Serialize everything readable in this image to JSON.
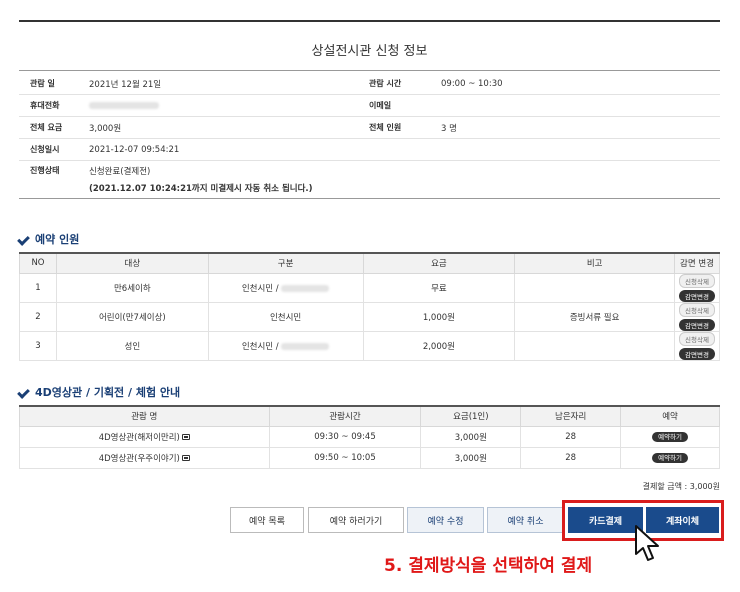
{
  "page_title": "상설전시관 신청 정보",
  "info": {
    "view_date_label": "관람 일",
    "view_date": "2021년 12월 21일",
    "view_time_label": "관람 시간",
    "view_time": "09:00 ~ 10:30",
    "phone_label": "휴대전화",
    "email_label": "이메일",
    "total_fee_label": "전체 요금",
    "total_fee": "3,000원",
    "total_people_label": "전체 인원",
    "total_people": "3 명",
    "applied_at_label": "신청일시",
    "applied_at": "2021-12-07 09:54:21",
    "status_label": "진행상태",
    "status": "신청완료(결제전)",
    "notice": "(2021.12.07 10:24:21까지 미결제시 자동 취소 됩니다.)"
  },
  "reservation": {
    "heading": "예약 인원",
    "columns": [
      "NO",
      "대상",
      "구분",
      "요금",
      "비고",
      "감면 변경"
    ],
    "rows": [
      {
        "no": "1",
        "target": "만6세이하",
        "category": "인천시민 /",
        "fee": "무료",
        "note": ""
      },
      {
        "no": "2",
        "target": "어린이(만7세이상)",
        "category": "인천시민",
        "fee": "1,000원",
        "note": "증빙서류 필요"
      },
      {
        "no": "3",
        "target": "성인",
        "category": "인천시민 /",
        "fee": "2,000원",
        "note": ""
      }
    ],
    "apply_label": "신청삭제",
    "change_label": "감면변경"
  },
  "program": {
    "heading": "4D영상관 / 기획전 / 체험 안내",
    "columns": [
      "관람 명",
      "관람시간",
      "요금(1인)",
      "남은자리",
      "예약"
    ],
    "rows": [
      {
        "name": "4D영상관(해저이만리)",
        "time": "09:30 ~ 09:45",
        "fee": "3,000원",
        "seats": "28",
        "action": "예약하기"
      },
      {
        "name": "4D영상관(우주이야기)",
        "time": "09:50 ~ 10:05",
        "fee": "3,000원",
        "seats": "28",
        "action": "예약하기"
      }
    ],
    "total": "결제할 금액 : 3,000원"
  },
  "buttons": {
    "list": "예약 목록",
    "more": "예약 하러가기",
    "edit": "예약 수정",
    "cancel": "예약 취소",
    "card": "카드결제",
    "transfer": "계좌이체"
  },
  "instruction": "5. 결제방식을 선택하여 결제",
  "colors": {
    "primary": "#1a4b8c",
    "highlight": "#d91d1d",
    "heading": "#1a3f75"
  }
}
